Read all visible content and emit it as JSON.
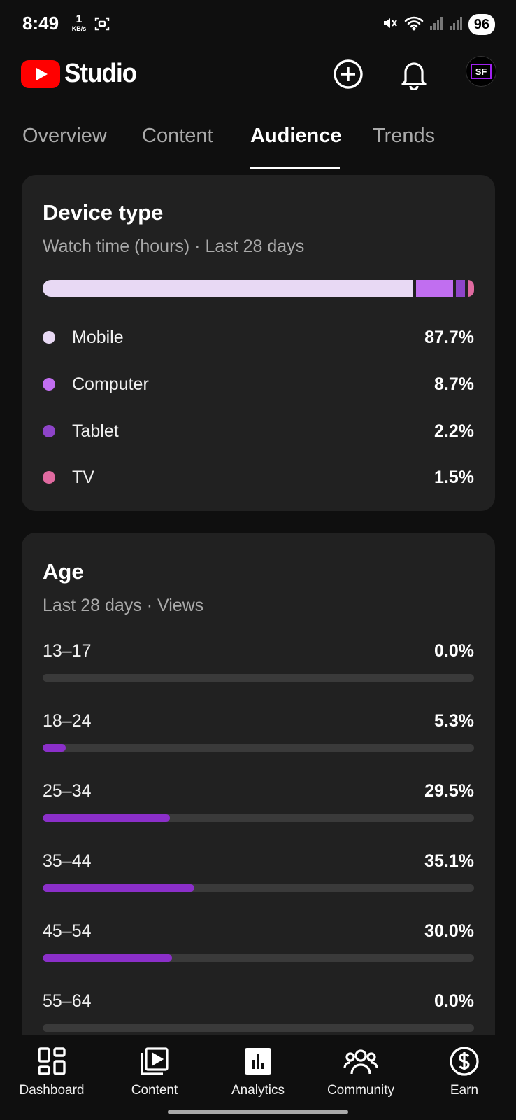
{
  "status_bar": {
    "time": "8:49",
    "net_speed": "1",
    "net_unit": "KB/s",
    "battery": "96"
  },
  "header": {
    "app_name": "Studio",
    "avatar_initials": "SF"
  },
  "tabs": [
    {
      "label": "Overview",
      "active": false
    },
    {
      "label": "Content",
      "active": false
    },
    {
      "label": "Audience",
      "active": true
    },
    {
      "label": "Trends",
      "active": false
    }
  ],
  "device_card": {
    "title": "Device type",
    "subtitle": "Watch time (hours) · Last 28 days",
    "items": [
      {
        "label": "Mobile",
        "value": "87.7%",
        "pct": 87.7,
        "color": "#e8d9f4"
      },
      {
        "label": "Computer",
        "value": "8.7%",
        "pct": 8.7,
        "color": "#c16ef0"
      },
      {
        "label": "Tablet",
        "value": "2.2%",
        "pct": 2.2,
        "color": "#8e44c9"
      },
      {
        "label": "TV",
        "value": "1.5%",
        "pct": 1.5,
        "color": "#e06aa0"
      }
    ]
  },
  "age_card": {
    "title": "Age",
    "subtitle": "Last 28 days · Views",
    "rows": [
      {
        "label": "13–17",
        "value": "0.0%",
        "pct": 0.0
      },
      {
        "label": "18–24",
        "value": "5.3%",
        "pct": 5.3
      },
      {
        "label": "25–34",
        "value": "29.5%",
        "pct": 29.5
      },
      {
        "label": "35–44",
        "value": "35.1%",
        "pct": 35.1
      },
      {
        "label": "45–54",
        "value": "30.0%",
        "pct": 30.0
      },
      {
        "label": "55–64",
        "value": "0.0%",
        "pct": 0.0
      }
    ]
  },
  "bottom_nav": [
    {
      "label": "Dashboard",
      "icon": "dashboard-icon"
    },
    {
      "label": "Content",
      "icon": "content-icon"
    },
    {
      "label": "Analytics",
      "icon": "analytics-icon",
      "active": true
    },
    {
      "label": "Community",
      "icon": "community-icon"
    },
    {
      "label": "Earn",
      "icon": "earn-icon"
    }
  ],
  "colors": {
    "background": "#0f0f0f",
    "card": "#212121",
    "age_fill": "#8b2fc9",
    "brand_red": "#ff0000"
  }
}
